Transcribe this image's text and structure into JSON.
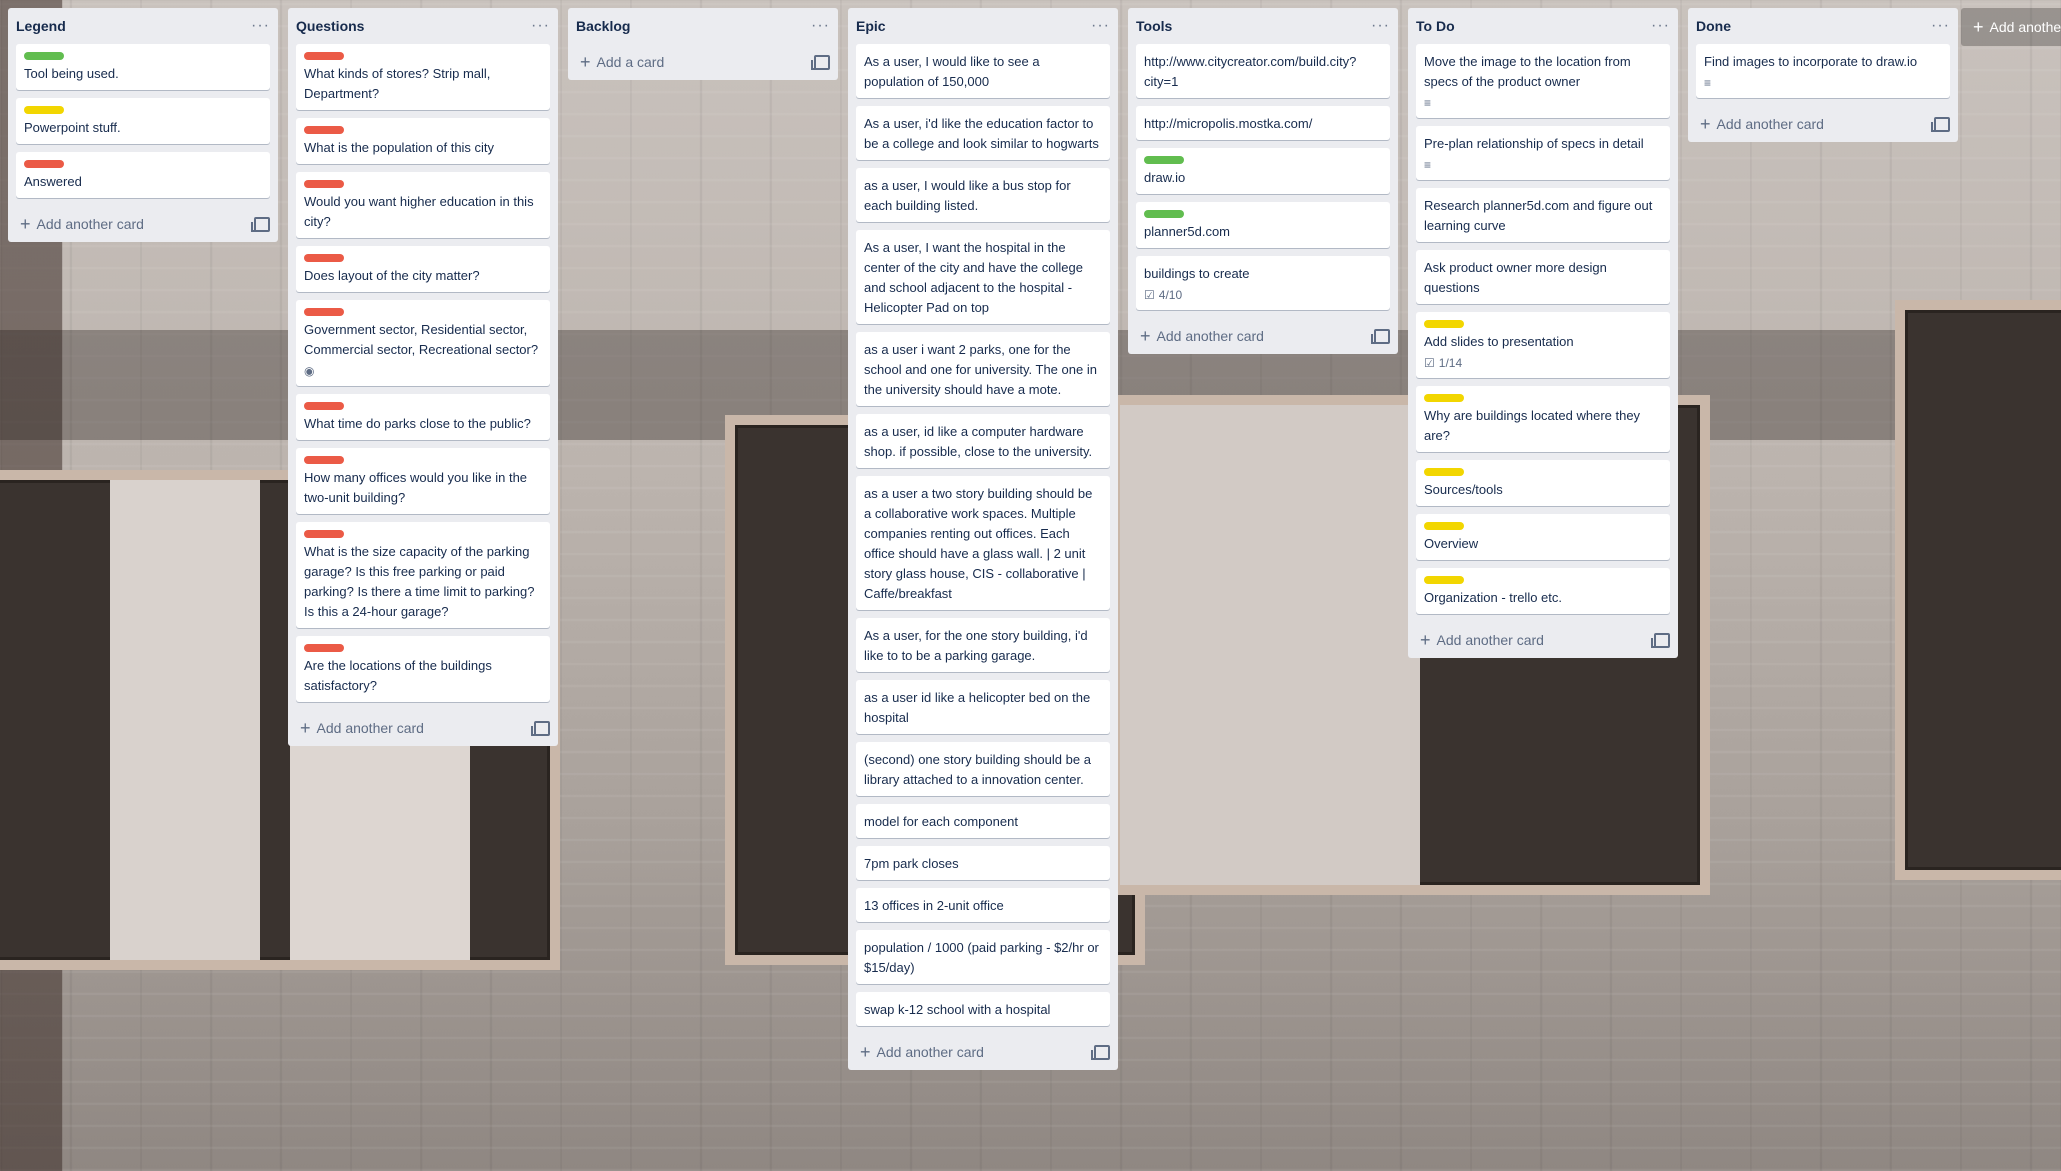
{
  "board": {
    "add_list_label": "Add another list",
    "lists": [
      {
        "title": "Legend",
        "add_label": "Add another card",
        "cards": [
          {
            "label": "green",
            "text": "Tool being used."
          },
          {
            "label": "yellow",
            "text": "Powerpoint stuff."
          },
          {
            "label": "red",
            "text": "Answered"
          }
        ]
      },
      {
        "title": "Questions",
        "add_label": "Add another card",
        "cards": [
          {
            "label": "red",
            "text": "What kinds of stores? Strip mall, Department?"
          },
          {
            "label": "red",
            "text": "What is the population of this city"
          },
          {
            "label": "red",
            "text": "Would you want higher education in this city?"
          },
          {
            "label": "red",
            "text": "Does layout of the city matter?"
          },
          {
            "label": "red",
            "text": "Government sector, Residential sector, Commercial sector, Recreational sector?",
            "badge": "watch"
          },
          {
            "label": "red",
            "text": "What time do parks close to the public?"
          },
          {
            "label": "red",
            "text": "How many offices would you like in the two-unit building?"
          },
          {
            "label": "red",
            "text": "What is the size capacity of the parking garage? Is this free parking or paid parking? Is there a time limit to parking? Is this a 24-hour garage?"
          },
          {
            "label": "red",
            "text": "Are the locations of the buildings satisfactory?"
          }
        ]
      },
      {
        "title": "Backlog",
        "add_label": "Add a card",
        "cards": []
      },
      {
        "title": "Epic",
        "add_label": "Add another card",
        "cards": [
          {
            "text": "As a user, I would like to see a population of 150,000"
          },
          {
            "text": "As a user, i'd like the education factor to be a college and look similar to hogwarts"
          },
          {
            "text": "as a user, I would like a bus stop for each building listed."
          },
          {
            "text": "As a user, I want the hospital in the center of the city and have the college and school adjacent to the hospital - Helicopter Pad on top"
          },
          {
            "text": "as a user i want 2 parks, one for the school and one for university. The one in the university should have a mote."
          },
          {
            "text": "as a user, id like a computer hardware shop. if possible, close to the university."
          },
          {
            "text": "as a user a two story building should be a collaborative work spaces. Multiple companies renting out offices. Each office should have a glass wall. | 2 unit story glass house, CIS - collaborative | Caffe/breakfast"
          },
          {
            "text": "As a user, for the one story building, i'd like to to be a parking garage."
          },
          {
            "text": "as a user id like a helicopter bed on the hospital"
          },
          {
            "text": "(second) one story building should be a library attached to a innovation center."
          },
          {
            "text": "model for each component"
          },
          {
            "text": "7pm park closes"
          },
          {
            "text": "13 offices in 2-unit office"
          },
          {
            "text": "population / 1000 (paid parking - $2/hr or $15/day)"
          },
          {
            "text": "swap k-12 school with a hospital"
          }
        ]
      },
      {
        "title": "Tools",
        "add_label": "Add another card",
        "cards": [
          {
            "text": "http://www.citycreator.com/build.city?city=1"
          },
          {
            "text": "http://micropolis.mostka.com/"
          },
          {
            "label": "green",
            "text": "draw.io"
          },
          {
            "label": "green",
            "text": "planner5d.com"
          },
          {
            "text": "buildings to create",
            "badge": "checklist",
            "badge_text": "4/10"
          }
        ]
      },
      {
        "title": "To Do",
        "add_label": "Add another card",
        "cards": [
          {
            "text": "Move the image to the location from specs of the product owner",
            "badge": "description"
          },
          {
            "text": "Pre-plan relationship of specs in detail",
            "badge": "description"
          },
          {
            "text": "Research planner5d.com and figure out learning curve"
          },
          {
            "text": "Ask product owner more design questions"
          },
          {
            "label": "yellow",
            "text": "Add slides to presentation",
            "badge": "checklist",
            "badge_text": "1/14"
          },
          {
            "label": "yellow",
            "text": "Why are buildings located where they are?"
          },
          {
            "label": "yellow",
            "text": "Sources/tools"
          },
          {
            "label": "yellow",
            "text": "Overview"
          },
          {
            "label": "yellow",
            "text": "Organization - trello etc."
          }
        ]
      },
      {
        "title": "Done",
        "add_label": "Add another card",
        "cards": [
          {
            "text": "Find images to incorporate to draw.io",
            "badge": "description"
          }
        ]
      }
    ]
  }
}
